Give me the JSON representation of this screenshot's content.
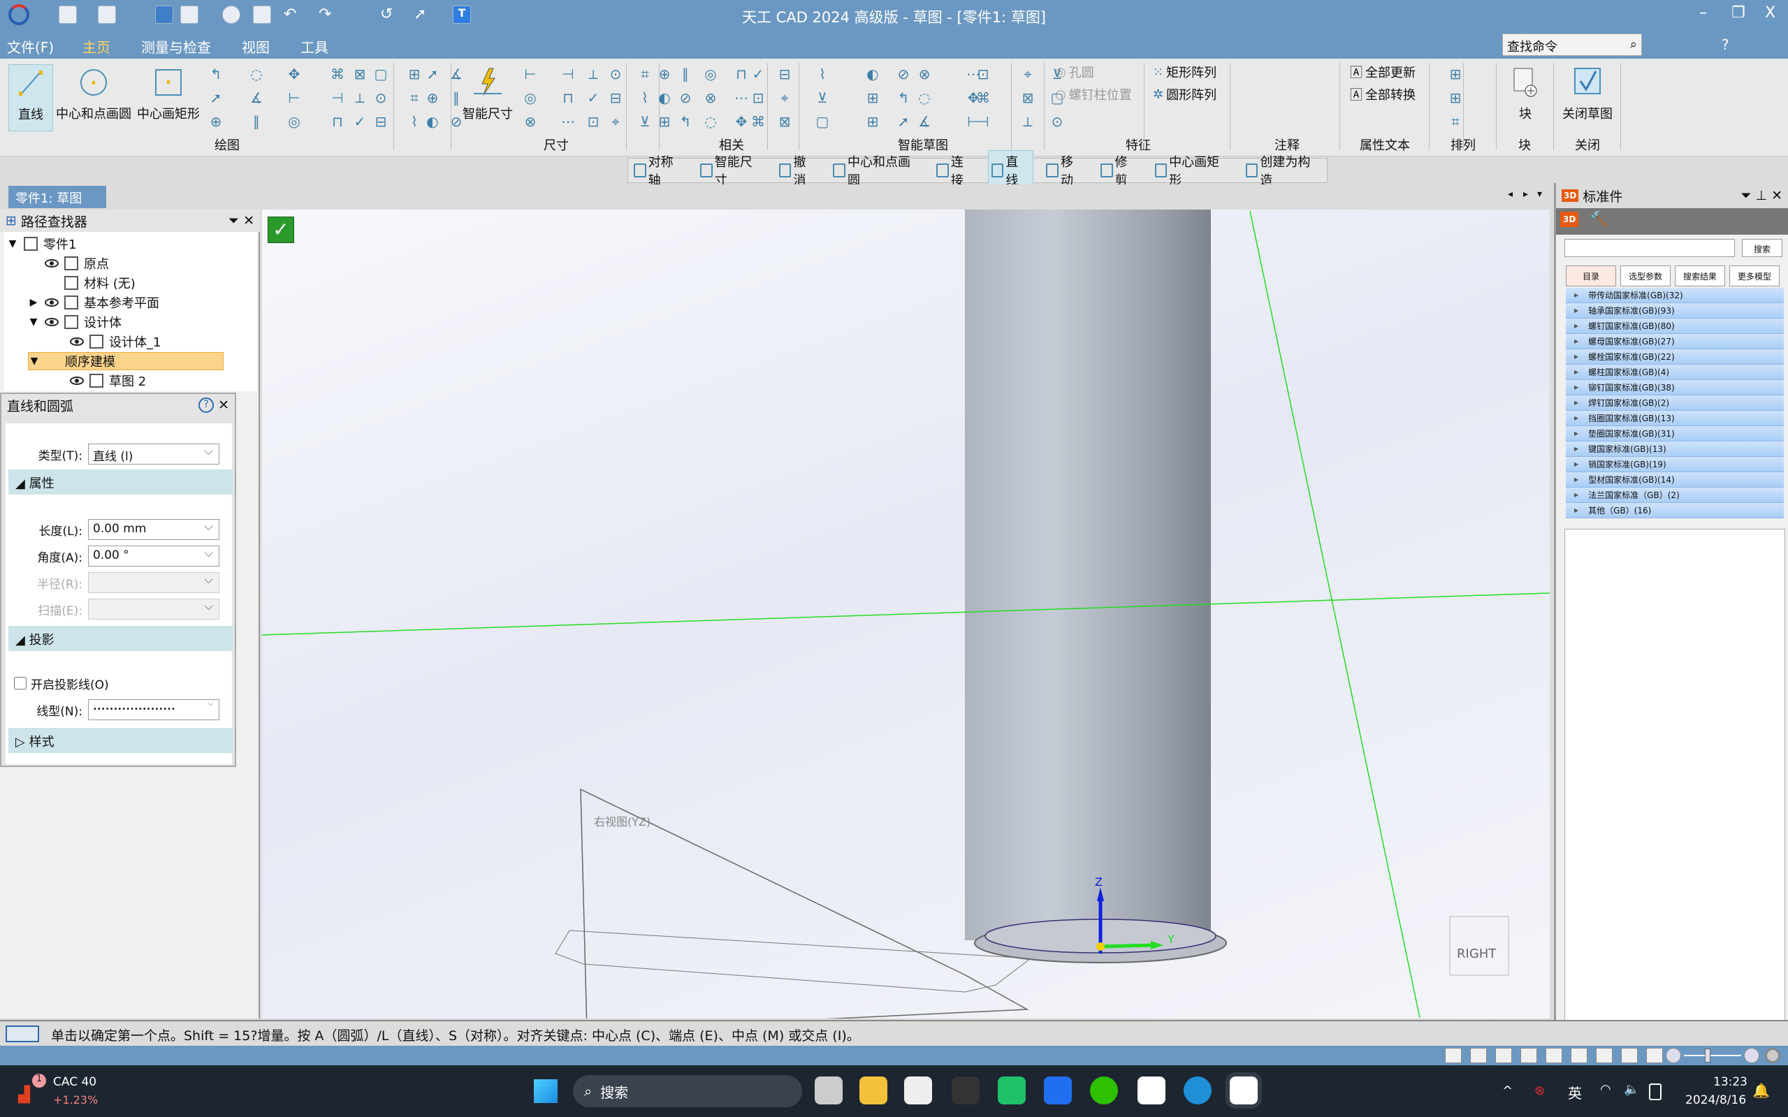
{
  "titlebar": {
    "title": "天工 CAD 2024 高级版 - 草图 - [零件1: 草图]",
    "min": "–",
    "restore": "❐",
    "close": "X"
  },
  "menu": {
    "items": [
      "文件(F)",
      "主页",
      "测量与检查",
      "视图",
      "工具"
    ],
    "active": 1,
    "find_placeholder": "查找命令",
    "help": "?"
  },
  "ribbon": {
    "big_buttons": [
      {
        "label": "直线",
        "icon": "line-icon"
      },
      {
        "label": "中心和点画圆",
        "icon": "circle-icon"
      },
      {
        "label": "中心画矩形",
        "icon": "rectangle-icon"
      },
      {
        "label": "智能尺寸",
        "icon": "smart-dimension-icon"
      },
      {
        "label": "块",
        "icon": "block-icon"
      },
      {
        "label": "关闭草图",
        "icon": "close-sketch-icon"
      }
    ],
    "groups": [
      "绘图",
      "尺寸",
      "相关",
      "智能草图",
      "特征",
      "注释",
      "属性文本",
      "排列",
      "块",
      "关闭"
    ],
    "feature_buttons": [
      {
        "label": "孔圆",
        "disabled": true
      },
      {
        "label": "螺钉柱位置",
        "disabled": true
      },
      {
        "label": "矩形阵列",
        "disabled": false
      },
      {
        "label": "圆形阵列",
        "disabled": false
      }
    ],
    "attr_buttons": [
      "全部更新",
      "全部转换"
    ]
  },
  "context_toolbar": [
    {
      "label": "对称轴"
    },
    {
      "label": "智能尺寸"
    },
    {
      "label": "撤消"
    },
    {
      "label": "中心和点画圆"
    },
    {
      "label": "连接"
    },
    {
      "label": "直线",
      "selected": true
    },
    {
      "label": "移动"
    },
    {
      "label": "修剪"
    },
    {
      "label": "中心画矩形"
    },
    {
      "label": "创建为构造"
    }
  ],
  "doc_tab": "零件1: 草图",
  "pathfinder": {
    "title": "路径查找器",
    "tree": [
      {
        "label": "零件1",
        "level": 0,
        "expander": "▼"
      },
      {
        "label": "原点",
        "level": 1,
        "eye": true
      },
      {
        "label": "材料 (无)",
        "level": 1
      },
      {
        "label": "基本参考平面",
        "level": 1,
        "eye": true,
        "expander": "▶"
      },
      {
        "label": "设计体",
        "level": 1,
        "eye": true,
        "expander": "▼"
      },
      {
        "label": "设计体_1",
        "level": 2,
        "eye": true
      },
      {
        "label": "顺序建模",
        "level": 1,
        "expander": "▼",
        "highlight": true
      },
      {
        "label": "草图 2",
        "level": 2,
        "eye": true
      }
    ]
  },
  "line_arc": {
    "title": "直线和圆弧",
    "type_label": "类型(T):",
    "type_value": "直线 (l)",
    "sec_props": "属性",
    "length_label": "长度(L):",
    "length_value": "0.00 mm",
    "angle_label": "角度(A):",
    "angle_value": "0.00 °",
    "radius_label": "半径(R):",
    "sweep_label": "扫描(E):",
    "sec_proj": "投影",
    "proj_check": "开启投影线(O)",
    "proj_checked": false,
    "linetype_label": "线型(N):",
    "linetype_value": "••••••••••••••••••••",
    "sec_style": "样式"
  },
  "viewport": {
    "plane_label": "右视图(YZ)",
    "axis_z": "Z",
    "axis_y": "Y",
    "view_cube": "RIGHT",
    "accept": "✓"
  },
  "std_parts": {
    "title": "标准件",
    "search_btn": "搜索",
    "search_value": "",
    "tabs": [
      "目录",
      "选型参数",
      "搜索结果",
      "更多模型"
    ],
    "active_tab": 0,
    "items": [
      "带传动国家标准(GB)(32)",
      "轴承国家标准(GB)(93)",
      "螺钉国家标准(GB)(80)",
      "螺母国家标准(GB)(27)",
      "螺栓国家标准(GB)(22)",
      "螺柱国家标准(GB)(4)",
      "铆钉国家标准(GB)(38)",
      "焊钉国家标准(GB)(2)",
      "挡圈国家标准(GB)(13)",
      "垫圈国家标准(GB)(31)",
      "键国家标准(GB)(13)",
      "销国家标准(GB)(19)",
      "型材国家标准(GB)(14)",
      "法兰国家标准（GB）(2)",
      "其他（GB）(16)"
    ]
  },
  "status": {
    "text": "单击以确定第一个点。Shift = 15?增量。按 A（圆弧）/L（直线）、S（对称）。对齐关键点: 中心点 (C)、端点 (E)、中点 (M) 或交点 (I)。"
  },
  "taskbar": {
    "stock_name": "CAC 40",
    "stock_change": "+1.23%",
    "badge": "1",
    "search": "搜索",
    "ime": "英",
    "time": "13:23",
    "date": "2024/8/16"
  },
  "colors": {
    "accent": "#6b98c2",
    "sketch_line": "#22dd22",
    "highlight": "#fbd38a"
  }
}
